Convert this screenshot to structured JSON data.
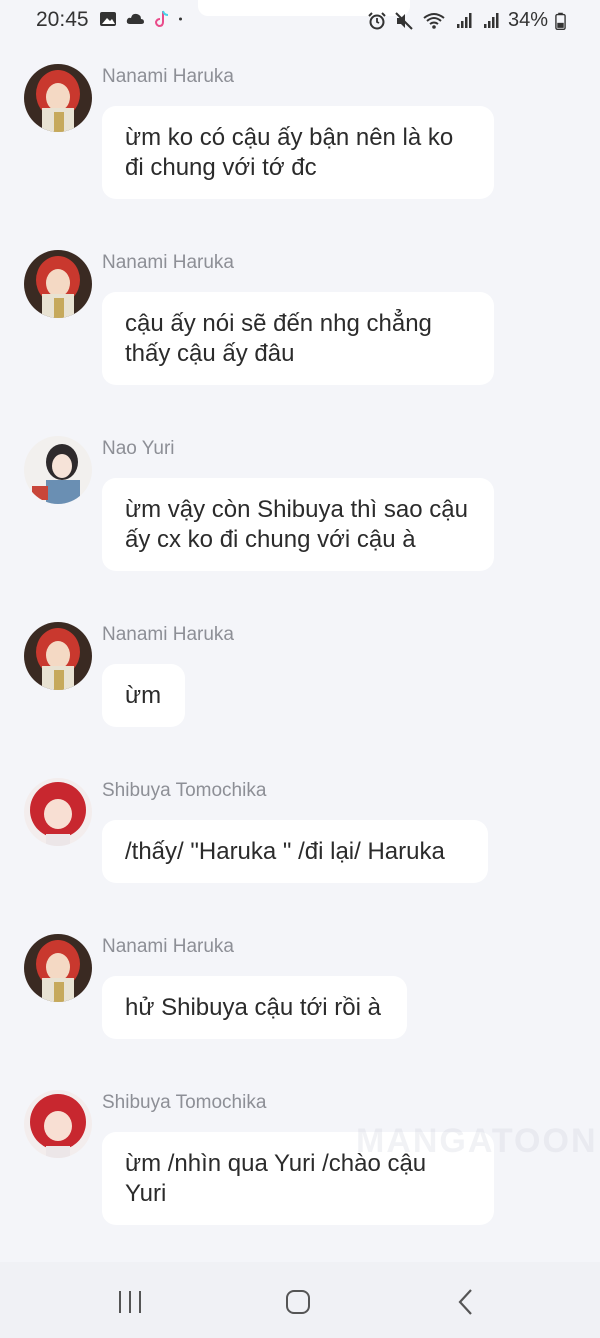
{
  "status_bar": {
    "time": "20:45",
    "battery": "34%",
    "left_icons": [
      "image-icon",
      "cloud-icon",
      "tiktok-icon",
      "dot-icon"
    ],
    "right_icons": [
      "alarm-icon",
      "mute-icon",
      "wifi-icon",
      "signal-icon",
      "signal-icon",
      "battery-icon"
    ]
  },
  "messages": [
    {
      "sender": "Nanami Haruka",
      "text": "ừm ko có cậu ấy bận nên là ko đi chung với tớ đc"
    },
    {
      "sender": "Nanami Haruka",
      "text": "cậu ấy nói sẽ đến nhg chẳng thấy cậu ấy đâu"
    },
    {
      "sender": "Nao Yuri",
      "text": "ừm vậy còn Shibuya thì sao cậu ấy cx ko đi chung với cậu à"
    },
    {
      "sender": "Nanami Haruka",
      "text": "ừm"
    },
    {
      "sender": "Shibuya Tomochika",
      "text": "/thấy/ \"Haruka \" /đi lại/ Haruka"
    },
    {
      "sender": "Nanami Haruka",
      "text": "hử Shibuya cậu tới rồi à"
    },
    {
      "sender": "Shibuya Tomochika",
      "text": "ừm /nhìn qua Yuri /chào cậu Yuri"
    }
  ],
  "watermark": "MANGATOON",
  "nav": {
    "icons": [
      "recent-apps-icon",
      "home-icon",
      "back-icon"
    ]
  },
  "colors": {
    "background": "#f4f5f9",
    "bubble": "#ffffff",
    "sender": "#8d8f96",
    "text": "#2b2b2b"
  }
}
